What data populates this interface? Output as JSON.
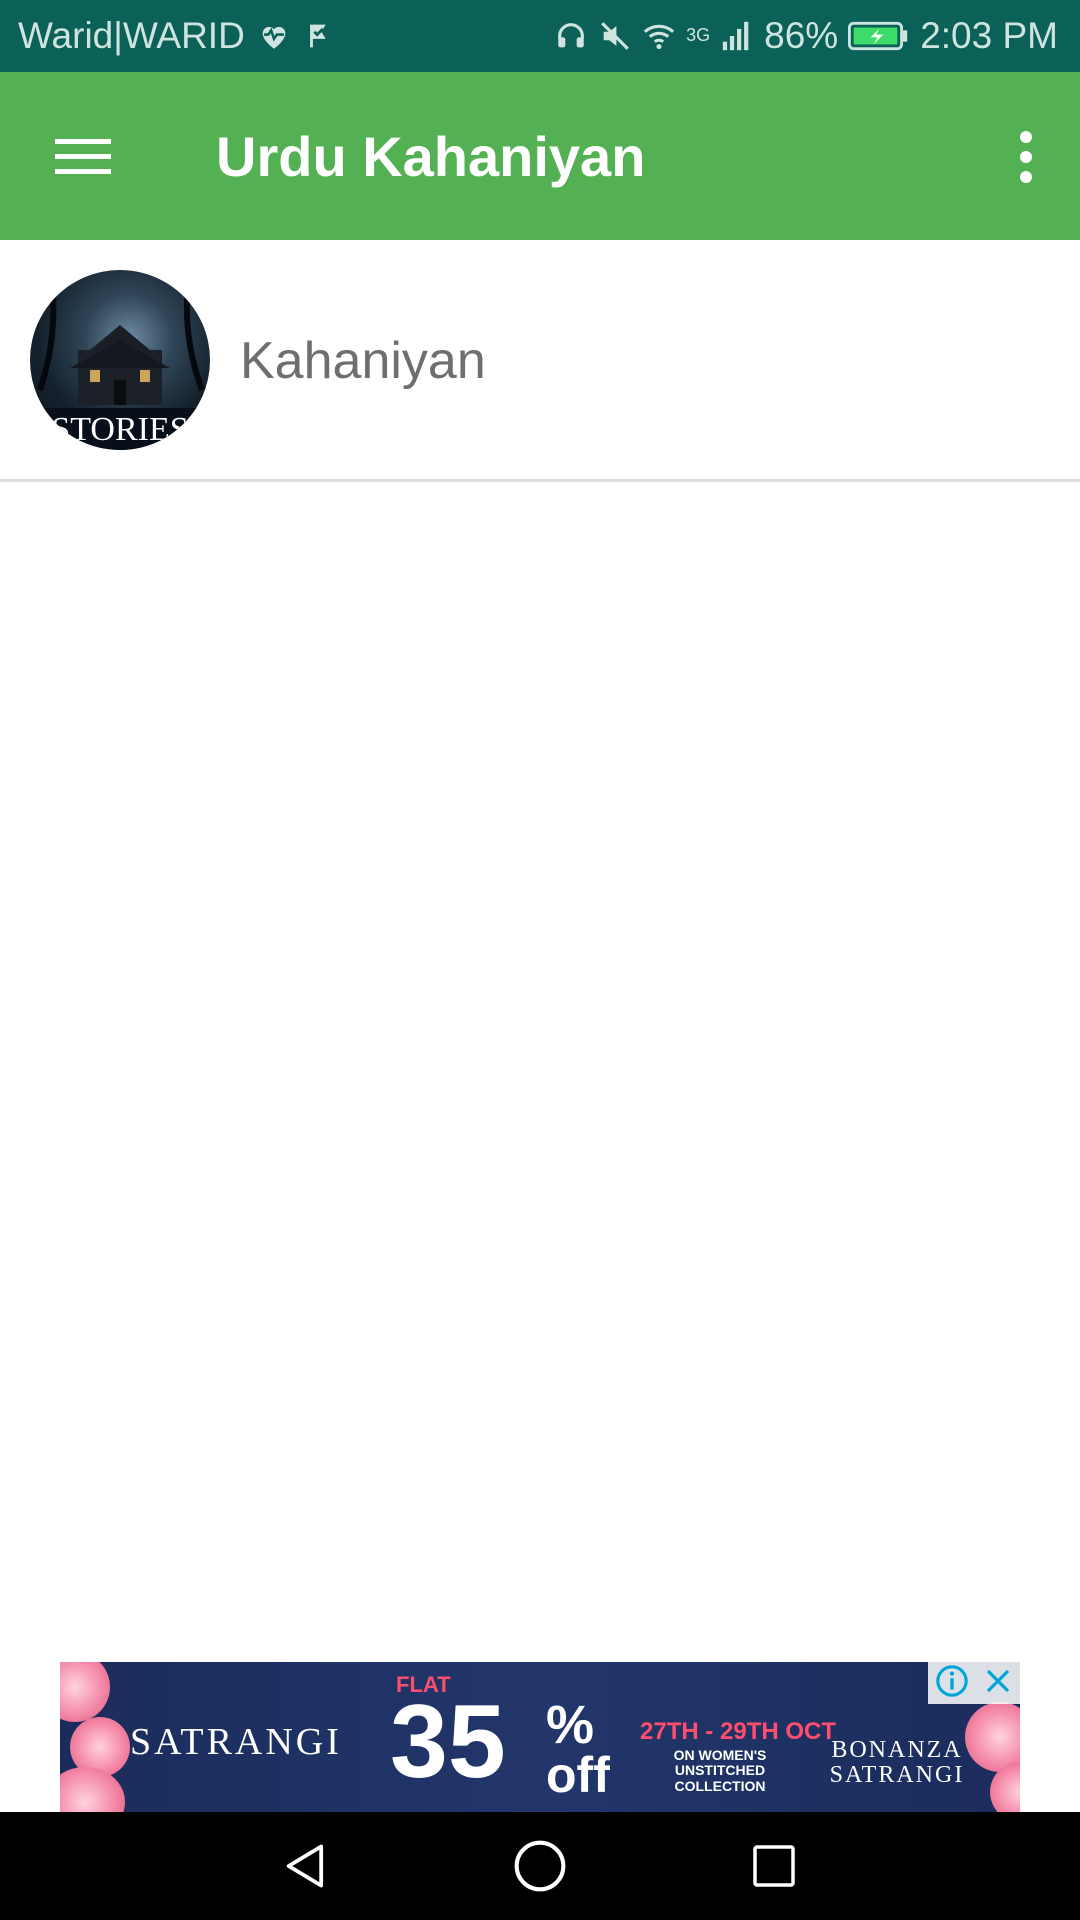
{
  "status_bar": {
    "carrier": "Warid|WARID",
    "battery": "86%",
    "time": "2:03 PM",
    "network": "3G",
    "icons": [
      "heart-pulse-icon",
      "check-flag-icon",
      "headphones-icon",
      "mute-icon",
      "wifi-icon",
      "signal-icon",
      "battery-charging-icon"
    ]
  },
  "app_bar": {
    "title": "Urdu Kahaniyan",
    "background": "#53b153",
    "menu_icon": "hamburger-menu-icon",
    "overflow_icon": "more-vert-icon"
  },
  "list": {
    "items": [
      {
        "label": "Kahaniyan",
        "avatar_text": "STORIES"
      }
    ]
  },
  "ad": {
    "brand": "SATRANGI",
    "flat": "FLAT",
    "discount": "35",
    "percent": "%",
    "off": "off",
    "dates": "27TH - 29TH OCT",
    "subtitle": "ON WOMEN'S UNSTITCHED COLLECTION",
    "campaign": "BONANZA SATRANGI",
    "info_icon": "info-icon",
    "close_icon": "close-icon"
  },
  "nav_bar": {
    "buttons": [
      "back-icon",
      "home-icon",
      "recents-icon"
    ]
  }
}
